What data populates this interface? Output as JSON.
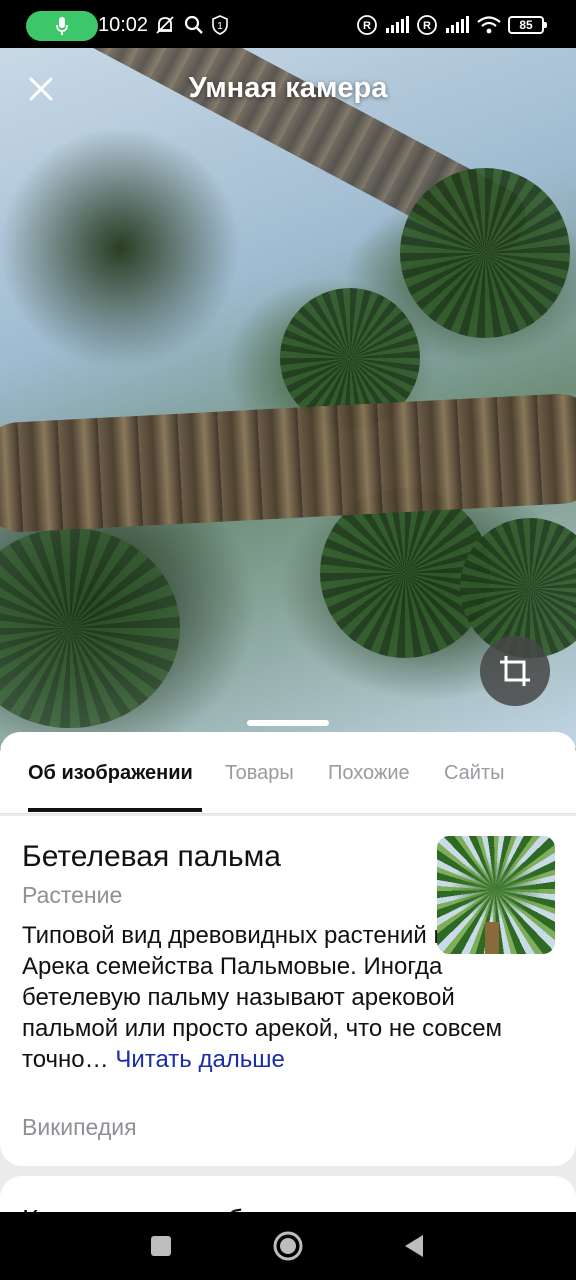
{
  "status_bar": {
    "time": "10:02",
    "battery": "85",
    "icons": [
      "mic-icon",
      "mute-icon",
      "search-icon",
      "sim-one-icon",
      "registered-icon",
      "signal-icon",
      "registered-icon",
      "signal-icon",
      "wifi-icon",
      "battery-icon"
    ]
  },
  "header": {
    "title": "Умная камера",
    "close_icon": "close-icon",
    "crop_icon": "crop-icon"
  },
  "tabs": [
    {
      "label": "Об изображении",
      "active": true
    },
    {
      "label": "Товары",
      "active": false
    },
    {
      "label": "Похожие",
      "active": false
    },
    {
      "label": "Сайты",
      "active": false
    }
  ],
  "info": {
    "title": "Бетелевая пальма",
    "subtitle": "Растение",
    "description": "Типовой вид древовидных растений из рода Арека семейства Пальмовые. Иногда бетелевую пальму называют арековой пальмой или просто арекой, что не совсем точно…",
    "read_more": "Читать дальше",
    "source": "Википедия"
  },
  "next_section": {
    "title": "Кажется, на изображении"
  },
  "nav_bar": {
    "icons": [
      "recents-square-icon",
      "home-circle-icon",
      "back-triangle-icon"
    ]
  },
  "colors": {
    "accent_link": "#1a2ea6",
    "mic_pill": "#3cc76a",
    "muted_text": "#8e9096"
  }
}
